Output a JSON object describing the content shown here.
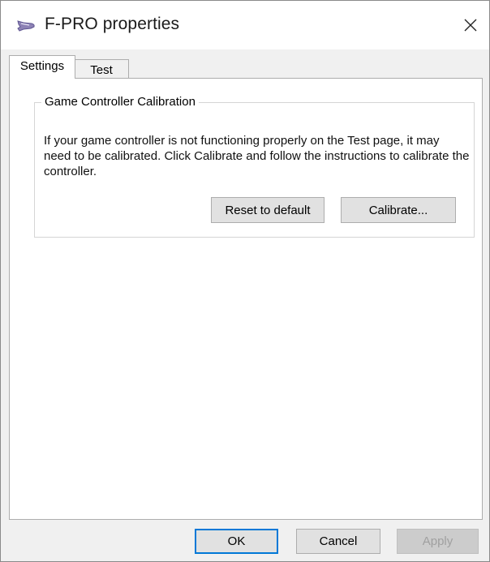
{
  "window": {
    "title": "F-PRO properties",
    "icon": "game-controller-icon",
    "close_glyph": "✕"
  },
  "tabs": [
    {
      "label": "Settings",
      "active": true
    },
    {
      "label": "Test",
      "active": false
    }
  ],
  "calibration": {
    "group_title": "Game Controller Calibration",
    "description": "If your game controller is not functioning properly on the Test page, it may need to be calibrated.  Click Calibrate and follow the instructions to calibrate the controller.",
    "reset_label": "Reset to default",
    "calibrate_label": "Calibrate..."
  },
  "footer": {
    "ok_label": "OK",
    "cancel_label": "Cancel",
    "apply_label": "Apply",
    "apply_enabled": false
  },
  "colors": {
    "focus_border": "#0078d7",
    "window_bg": "#f0f0f0",
    "panel_bg": "#ffffff"
  }
}
